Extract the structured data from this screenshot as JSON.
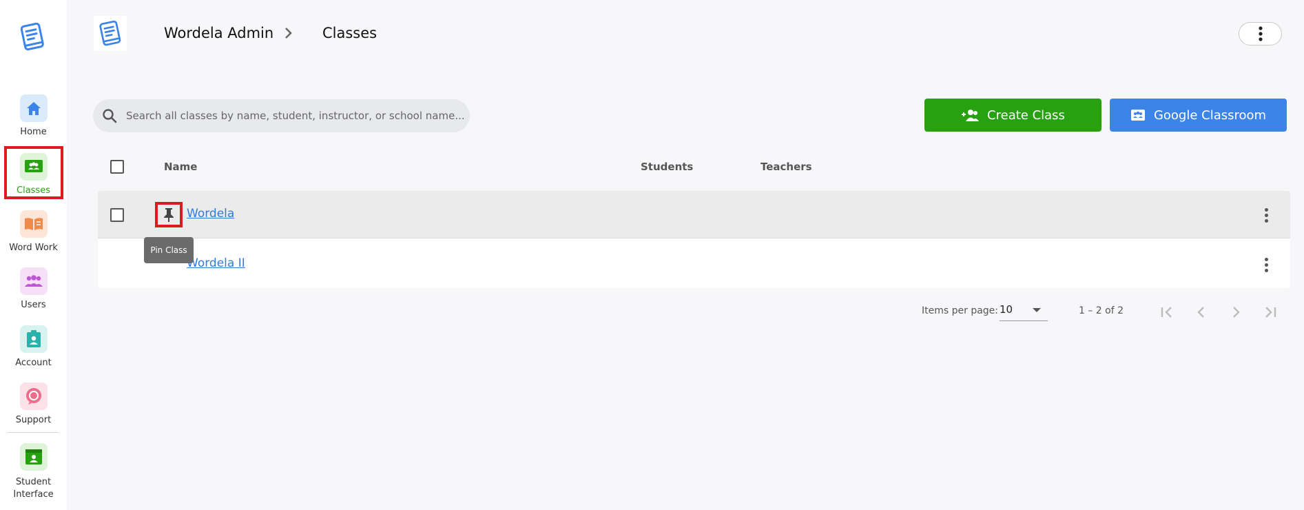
{
  "sidebar": {
    "logo": "book-logo-icon",
    "items": [
      {
        "label": "Home",
        "icon": "home-icon",
        "color": "#3d84e9",
        "bg": "#dbeafb"
      },
      {
        "label": "Classes",
        "icon": "classes-icon",
        "color": "#27a10f",
        "bg": "#dff3d9",
        "active": true
      },
      {
        "label": "Word Work",
        "icon": "open-book-icon",
        "color": "#f08a4b",
        "bg": "#fde6d8"
      },
      {
        "label": "Users",
        "icon": "users-icon",
        "color": "#c054d6",
        "bg": "#f5e0f8"
      },
      {
        "label": "Account",
        "icon": "account-icon",
        "color": "#29b2aa",
        "bg": "#d8f2f0"
      },
      {
        "label": "Support",
        "icon": "support-icon",
        "color": "#ee6d8c",
        "bg": "#fde1e8"
      },
      {
        "label_line1": "Student",
        "label_line2": "Interface",
        "icon": "student-interface-icon",
        "color": "#27a10f",
        "bg": "#dff3d9"
      }
    ]
  },
  "header": {
    "breadcrumb_root": "Wordela Admin",
    "breadcrumb_current": "Classes",
    "menu_icon": "more-vert-icon"
  },
  "search": {
    "placeholder": "Search all classes by name, student, instructor, or school name...",
    "value": ""
  },
  "actions": {
    "create_label": "Create Class",
    "google_label": "Google Classroom"
  },
  "table": {
    "columns": {
      "name": "Name",
      "students": "Students",
      "teachers": "Teachers"
    },
    "rows": [
      {
        "name": "Wordela",
        "students": "",
        "teachers": ""
      },
      {
        "name": "Wordela II",
        "students": "",
        "teachers": ""
      }
    ]
  },
  "tooltip": {
    "text": "Pin Class"
  },
  "paginator": {
    "items_per_page_label": "Items per page:",
    "page_size": "10",
    "range_label": "1 – 2 of 2"
  },
  "colors": {
    "primary_green": "#27a10f",
    "google_blue": "#3d84e9",
    "link_blue": "#2f7bdc",
    "highlight_red": "#e0191f"
  }
}
